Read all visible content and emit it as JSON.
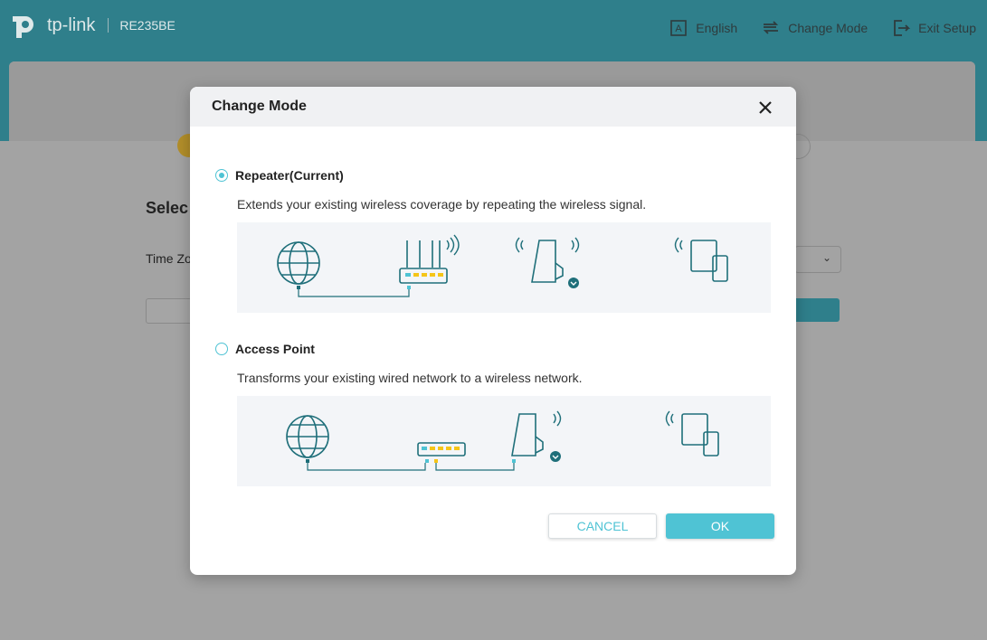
{
  "header": {
    "brand": "tp-link",
    "model": "RE235BE",
    "links": [
      {
        "label": "English",
        "icon": "language-icon"
      },
      {
        "label": "Change Mode",
        "icon": "change-mode-icon"
      },
      {
        "label": "Exit Setup",
        "icon": "exit-icon"
      }
    ]
  },
  "background": {
    "section_title": "Selec",
    "timezone_label": "Time Zo"
  },
  "modal": {
    "title": "Change Mode",
    "options": [
      {
        "label": "Repeater(Current)",
        "description": "Extends your existing wireless coverage by repeating the wireless signal.",
        "selected": true
      },
      {
        "label": "Access Point",
        "description": "Transforms your existing wired network to a wireless network.",
        "selected": false
      }
    ],
    "cancel_label": "CANCEL",
    "ok_label": "OK"
  },
  "colors": {
    "brand_teal": "#2f7f8b",
    "accent": "#4fc3d4",
    "icon_dark": "#1f6f7a",
    "port_yellow": "#f5c518"
  }
}
